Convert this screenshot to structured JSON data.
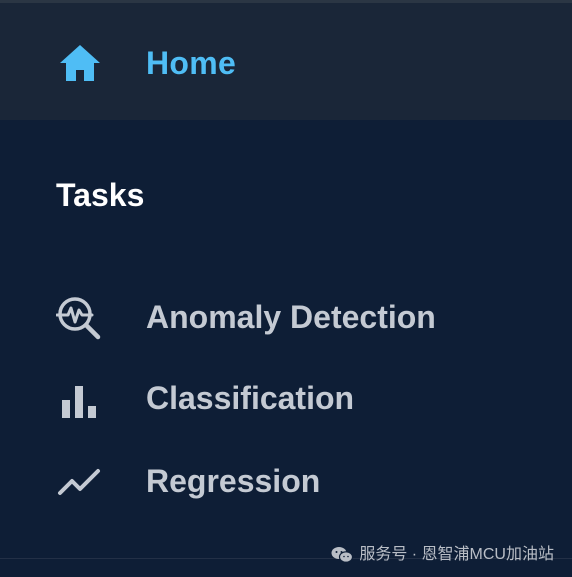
{
  "home": {
    "label": "Home",
    "icon": "home-icon",
    "color": "#4fbdf5"
  },
  "tasks": {
    "title": "Tasks",
    "items": [
      {
        "label": "Anomaly Detection",
        "icon": "anomaly-detection-icon"
      },
      {
        "label": "Classification",
        "icon": "bar-chart-icon"
      },
      {
        "label": "Regression",
        "icon": "trend-line-icon"
      }
    ]
  },
  "watermark": {
    "text": "服务号 · 恩智浦MCU加油站",
    "icon": "wechat-icon"
  },
  "colors": {
    "background": "#0e1e36",
    "home_background": "#1a2638",
    "item_text": "#c4cad3",
    "title_text": "#ffffff"
  }
}
